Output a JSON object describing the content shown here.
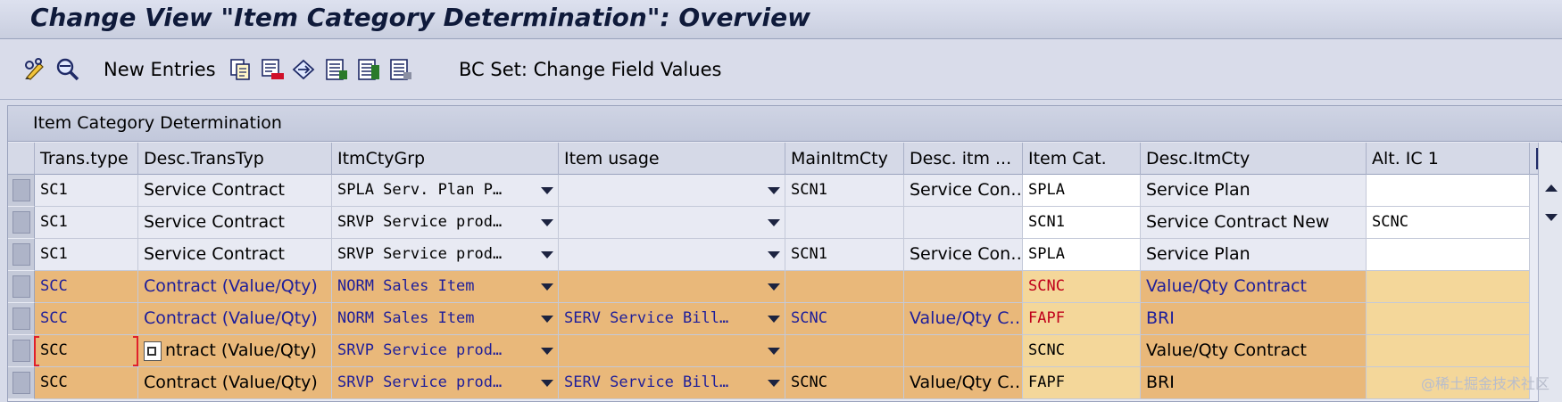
{
  "window": {
    "title": "Change View \"Item Category Determination\": Overview"
  },
  "toolbar": {
    "items": [
      {
        "type": "icon",
        "icon": "pencil-glasses-icon"
      },
      {
        "type": "icon",
        "icon": "magnifier-icon"
      },
      {
        "type": "text",
        "label": "New Entries"
      },
      {
        "type": "icon",
        "icon": "copy-icon"
      },
      {
        "type": "icon",
        "icon": "delete-icon"
      },
      {
        "type": "icon",
        "icon": "undo-icon"
      },
      {
        "type": "icon",
        "icon": "select-all-icon"
      },
      {
        "type": "icon",
        "icon": "select-block-icon"
      },
      {
        "type": "icon",
        "icon": "deselect-all-icon"
      },
      {
        "type": "text",
        "label": "BC Set: Change Field Values"
      }
    ]
  },
  "panel": {
    "title": "Item Category Determination"
  },
  "table": {
    "columns": [
      "Trans.type",
      "Desc.TransTyp",
      "ItmCtyGrp",
      "Item usage",
      "MainItmCty",
      "Desc. itm ...",
      "Item Cat.",
      "Desc.ItmCty",
      "Alt. IC 1"
    ],
    "rows": [
      {
        "style": "light",
        "trans_type": "SC1",
        "desc_trans": "Service Contract",
        "itm_cty_grp": "SPLA Serv. Plan P…",
        "item_usage": "",
        "main_itm_cty": "SCN1",
        "desc_itm": "Service Con…",
        "item_cat": "SPLA",
        "item_cat_color": "black",
        "desc_itm_cty": "Service Plan",
        "alt_ic1": ""
      },
      {
        "style": "light",
        "trans_type": "SC1",
        "desc_trans": "Service Contract",
        "itm_cty_grp": "SRVP Service prod…",
        "item_usage": "",
        "main_itm_cty": "",
        "desc_itm": "",
        "item_cat": "SCN1",
        "item_cat_color": "black",
        "desc_itm_cty": "Service Contract New",
        "alt_ic1": "SCNC"
      },
      {
        "style": "light",
        "trans_type": "SC1",
        "desc_trans": "Service Contract",
        "itm_cty_grp": "SRVP Service prod…",
        "item_usage": "",
        "main_itm_cty": "SCN1",
        "desc_itm": "Service Con…",
        "item_cat": "SPLA",
        "item_cat_color": "black",
        "desc_itm_cty": "Service Plan",
        "alt_ic1": ""
      },
      {
        "style": "orange",
        "trans_type": "SCC",
        "desc_trans": "Contract (Value/Qty)",
        "itm_cty_grp": "NORM Sales Item",
        "item_usage": "",
        "main_itm_cty": "",
        "desc_itm": "",
        "item_cat": "SCNC",
        "item_cat_color": "red",
        "desc_itm_cty": "Value/Qty Contract",
        "alt_ic1": "",
        "text_color": "blue"
      },
      {
        "style": "orange",
        "trans_type": "SCC",
        "desc_trans": "Contract (Value/Qty)",
        "itm_cty_grp": "NORM Sales Item",
        "item_usage": "SERV Service Bill…",
        "main_itm_cty": "SCNC",
        "desc_itm": "Value/Qty C…",
        "item_cat": "FAPF",
        "item_cat_color": "red",
        "desc_itm_cty": "BRI",
        "alt_ic1": "",
        "text_color": "blue"
      },
      {
        "style": "orange",
        "trans_type": "SCC",
        "desc_trans": "ntract (Value/Qty)",
        "itm_cty_grp": "SRVP Service prod…",
        "item_usage": "",
        "main_itm_cty": "",
        "desc_itm": "",
        "item_cat": "SCNC",
        "item_cat_color": "black",
        "desc_itm_cty": "Value/Qty Contract",
        "alt_ic1": "",
        "text_color": "black",
        "mixed": true
      },
      {
        "style": "orange",
        "trans_type": "SCC",
        "desc_trans": "Contract (Value/Qty)",
        "itm_cty_grp": "SRVP Service prod…",
        "item_usage": "SERV Service Bill…",
        "main_itm_cty": "SCNC",
        "desc_itm": "Value/Qty C…",
        "item_cat": "FAPF",
        "item_cat_color": "black",
        "desc_itm_cty": "BRI",
        "alt_ic1": "",
        "text_color": "black",
        "mixed": true
      }
    ]
  },
  "watermark": "@稀土掘金技术社区",
  "colors": {
    "orange_row": "#e9b87a",
    "light_row": "#e8eaf3",
    "blue_text": "#1e1e9a",
    "red_text": "#c0001a"
  }
}
